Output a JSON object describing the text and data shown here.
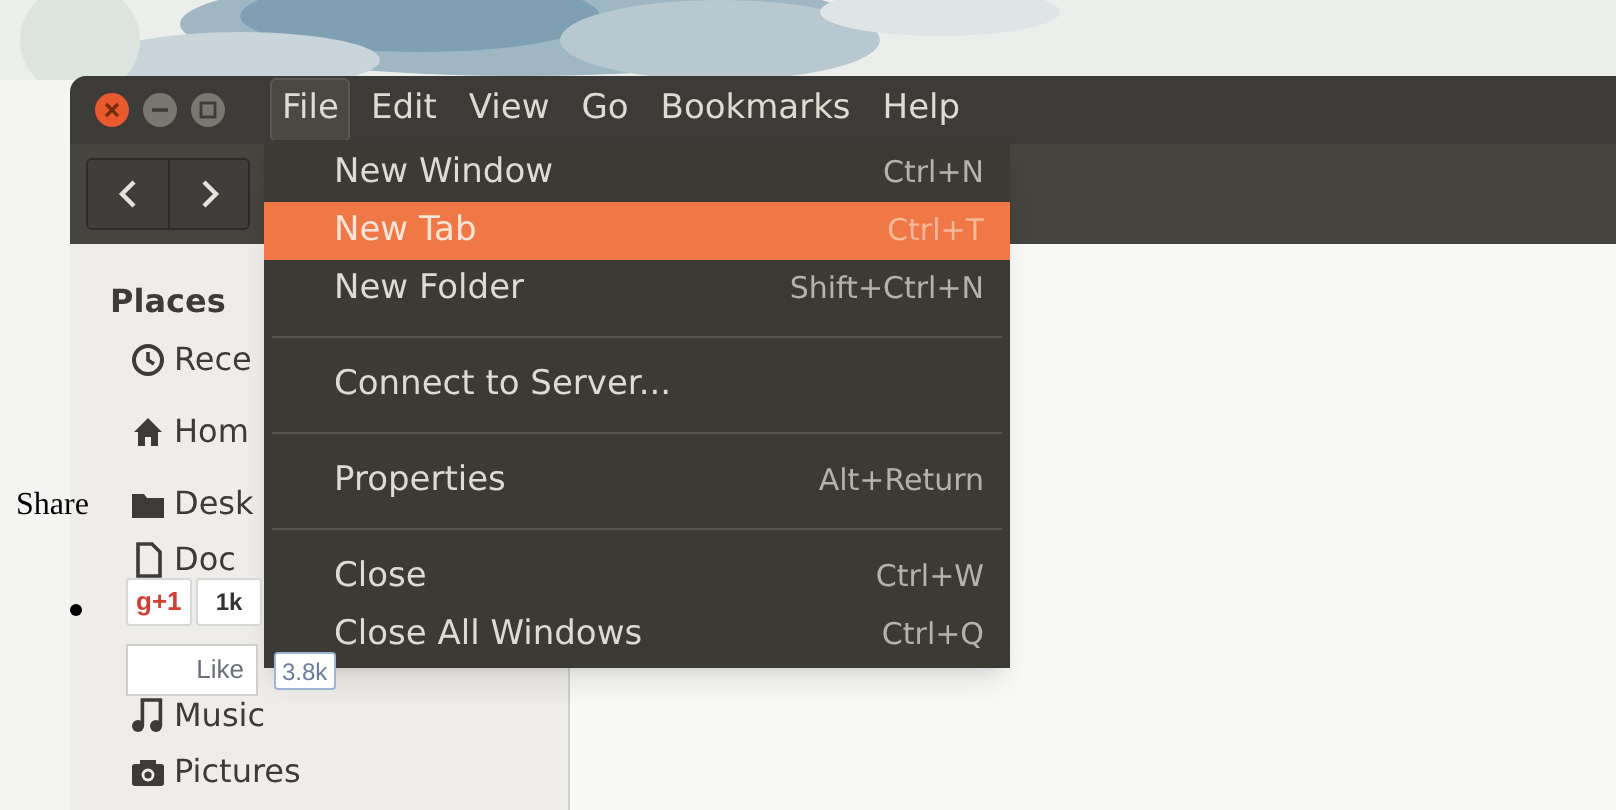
{
  "window": {
    "controls": [
      {
        "kind": "close"
      },
      {
        "kind": "minimize"
      },
      {
        "kind": "maximize"
      }
    ]
  },
  "menubar": [
    {
      "label": "File",
      "selected": true
    },
    {
      "label": "Edit",
      "selected": false
    },
    {
      "label": "View",
      "selected": false
    },
    {
      "label": "Go",
      "selected": false
    },
    {
      "label": "Bookmarks",
      "selected": false
    },
    {
      "label": "Help",
      "selected": false
    }
  ],
  "toolbar": {
    "nav": [
      {
        "kind": "back"
      },
      {
        "kind": "forward"
      }
    ]
  },
  "sidebar": {
    "heading": "Places",
    "items": [
      {
        "label": "Rece",
        "kind": "recent"
      },
      {
        "label": "Hom",
        "kind": "home"
      },
      {
        "label": "Desk",
        "kind": "folder"
      },
      {
        "label": "Doc",
        "kind": "document"
      },
      {
        "label": "Music",
        "kind": "music"
      },
      {
        "label": "Pictures",
        "kind": "pictures"
      }
    ]
  },
  "file_menu": {
    "items": [
      {
        "kind": "item",
        "label": "New Window",
        "shortcut": "Ctrl+N",
        "selected": false
      },
      {
        "kind": "item",
        "label": "New Tab",
        "shortcut": "Ctrl+T",
        "selected": true
      },
      {
        "kind": "item",
        "label": "New Folder",
        "shortcut": "Shift+Ctrl+N",
        "selected": false
      },
      {
        "kind": "separator"
      },
      {
        "kind": "item",
        "label": "Connect to Server...",
        "selected": false
      },
      {
        "kind": "separator"
      },
      {
        "kind": "item",
        "label": "Properties",
        "shortcut": "Alt+Return",
        "selected": false
      },
      {
        "kind": "separator"
      },
      {
        "kind": "item",
        "label": "Close",
        "shortcut": "Ctrl+W",
        "selected": false
      },
      {
        "kind": "item",
        "label": "Close All Windows",
        "shortcut": "Ctrl+Q",
        "selected": false
      }
    ]
  },
  "share_widget": {
    "label": "Share",
    "plus_one": {
      "label": "g+1",
      "count": "1k"
    },
    "like": {
      "label": "Like",
      "count": "3.8k"
    }
  }
}
